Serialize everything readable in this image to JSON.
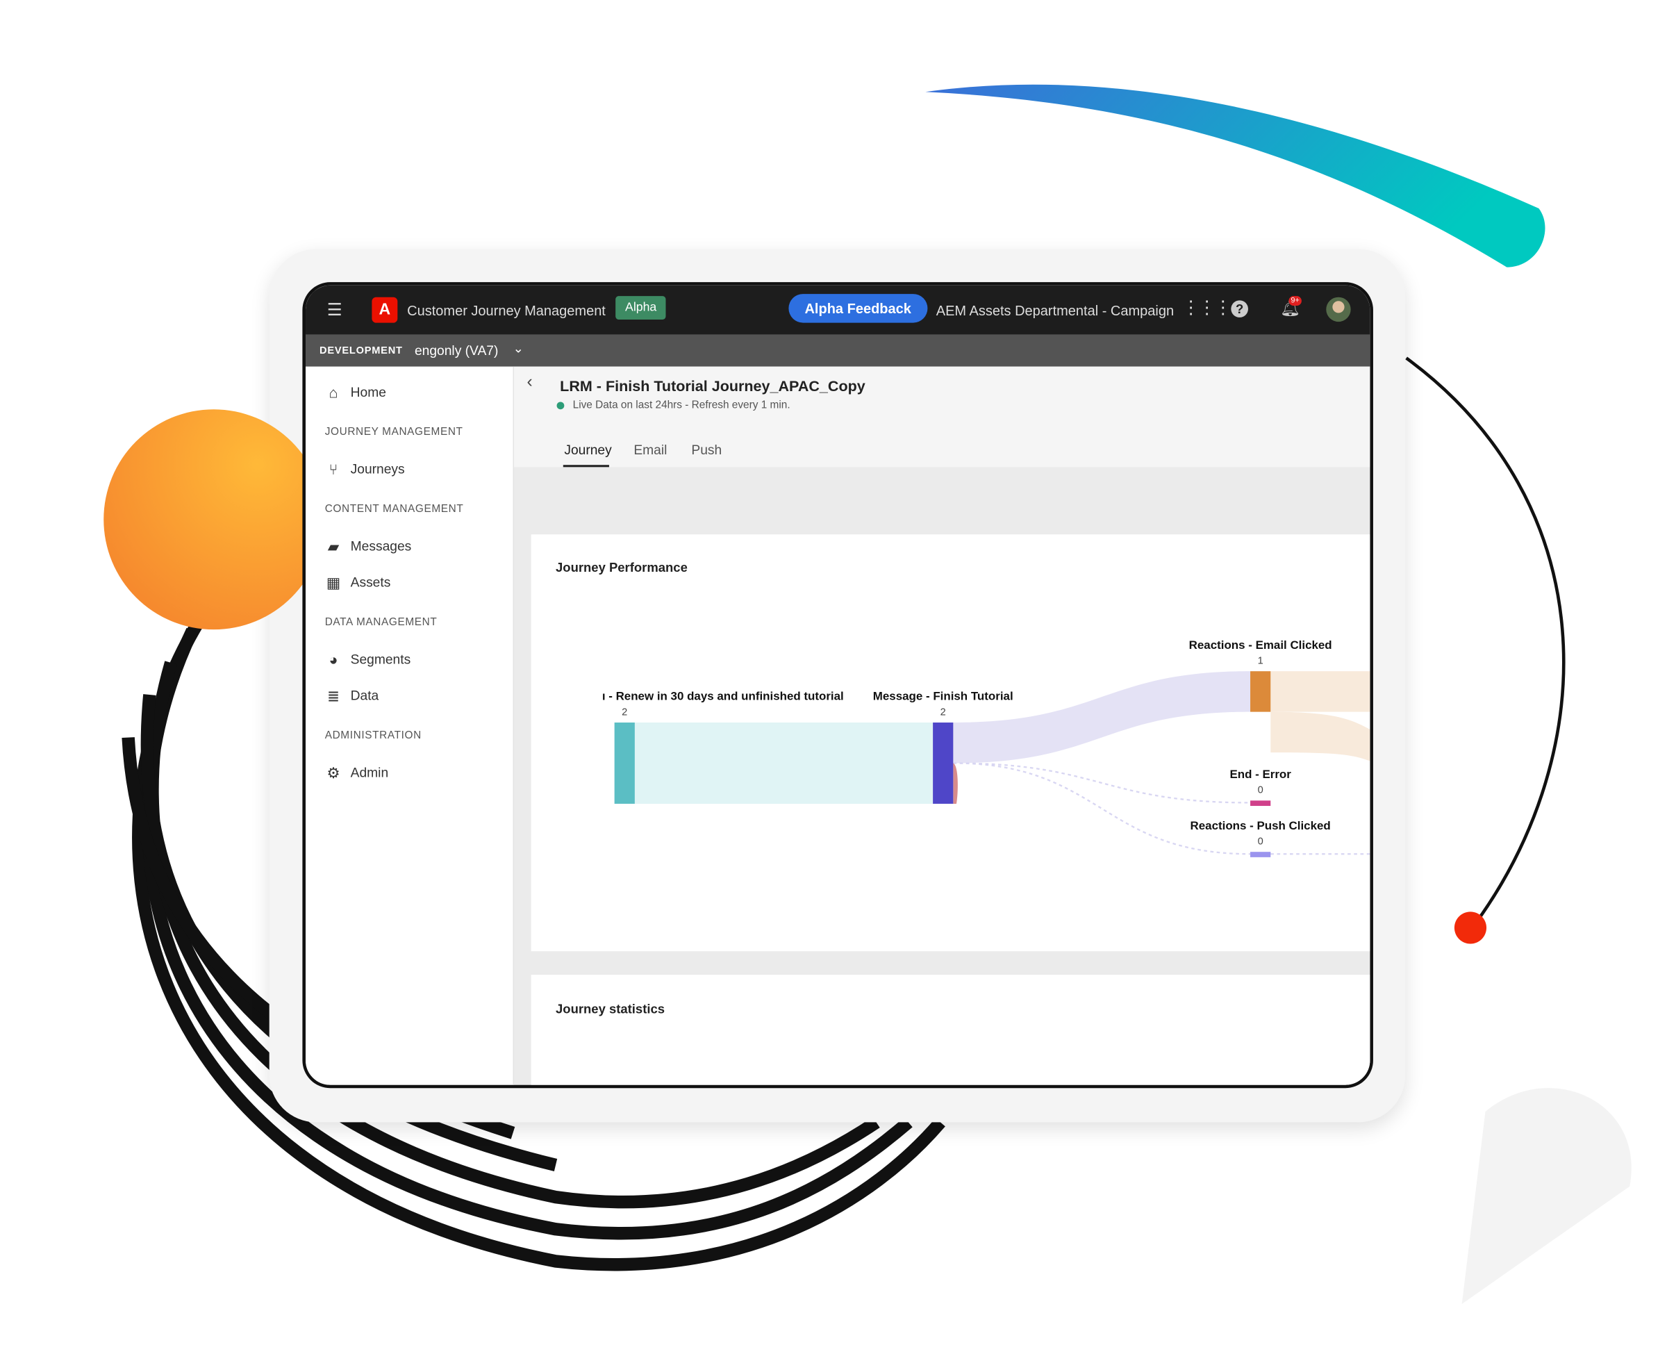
{
  "topbar": {
    "menu_icon": "hamburger-icon",
    "logo_icon": "adobe-logo",
    "app_title": "Customer Journey Management",
    "badge": "Alpha",
    "feedback_button": "Alpha Feedback",
    "org_name": "AEM Assets Departmental - Campaign",
    "apps_icon": "grid-icon",
    "help_icon": "help-icon",
    "notif_icon": "bell-icon",
    "notif_count": "9+",
    "avatar_icon": "user-avatar"
  },
  "devbar": {
    "env": "DEVELOPMENT",
    "sandbox": "engonly (VA7)"
  },
  "sidebar": {
    "home": "Home",
    "section1": "JOURNEY MANAGEMENT",
    "journeys": "Journeys",
    "section2": "CONTENT MANAGEMENT",
    "messages": "Messages",
    "assets": "Assets",
    "section3": "DATA MANAGEMENT",
    "segments": "Segments",
    "data": "Data",
    "section4": "ADMINISTRATION",
    "admin": "Admin"
  },
  "header": {
    "title": "LRM - Finish Tutorial Journey_APAC_Copy",
    "status": "Live Data on last 24hrs - Refresh every 1 min.",
    "status_color": "#2d9d78",
    "tabs": [
      "Journey",
      "Email",
      "Push"
    ],
    "active_tab": "Journey"
  },
  "cards": {
    "performance": "Journey Performance",
    "statistics": "Journey statistics"
  },
  "colors": {
    "accent": "#2d6fe0",
    "badge": "#3d8b63",
    "adobe": "#eb1000"
  },
  "chart_data": {
    "type": "sankey",
    "title": "Journey Performance",
    "nodes": [
      {
        "label": "ı - Renew in 30 days and unfinished tutorial",
        "value": 2,
        "color": "#5bbec4"
      },
      {
        "label": "Message - Finish Tutorial",
        "value": 2,
        "color": "#4f46c8"
      },
      {
        "label": "Reactions - Email Clicked",
        "value": 1,
        "color": "#dc8a3a"
      },
      {
        "label": "End - Error",
        "value": 0,
        "color": "#d0408a"
      },
      {
        "label": "Reactions - Push Clicked",
        "value": 0,
        "color": "#9b94ee"
      }
    ],
    "links": [
      {
        "source": 0,
        "target": 1,
        "value": 2,
        "color": "#e0f4f5"
      },
      {
        "source": 1,
        "target": 2,
        "value": 1,
        "color": "#e4e2f5"
      },
      {
        "source": 1,
        "target": 3,
        "value": 0,
        "color": "#d8d6f2"
      },
      {
        "source": 1,
        "target": 4,
        "value": 0,
        "color": "#d8d6f2"
      }
    ]
  }
}
